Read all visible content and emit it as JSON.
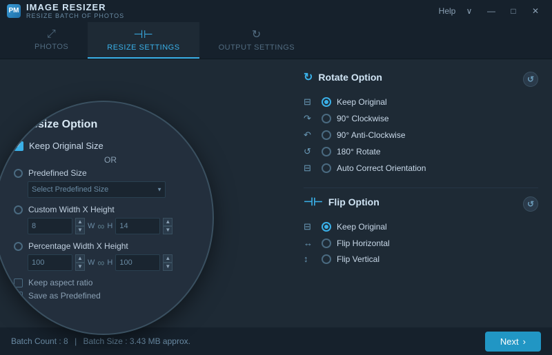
{
  "app": {
    "icon": "PM",
    "name": "IMAGE RESIZER",
    "subtitle": "RESIZE BATCH OF PHOTOS"
  },
  "titlebar": {
    "help_label": "Help",
    "minimize_label": "—",
    "maximize_label": "□",
    "close_label": "✕",
    "dropdown": "∨"
  },
  "tabs": [
    {
      "id": "photos",
      "label": "PHOTOS",
      "icon": "⤢",
      "active": false
    },
    {
      "id": "resize-settings",
      "label": "RESIZE SETTINGS",
      "icon": "⊣⊢",
      "active": true
    },
    {
      "id": "output-settings",
      "label": "OUTPUT SETTINGS",
      "icon": "↻",
      "active": false
    }
  ],
  "resize_option": {
    "title": "Resize Option",
    "keep_original": {
      "label": "Keep Original Size",
      "checked": true
    },
    "or_label": "OR",
    "predefined": {
      "label": "Predefined Size",
      "select_placeholder": "Select Predefined Size"
    },
    "custom_wh": {
      "label": "Custom Width X Height",
      "width_value": "8",
      "height_value": "14",
      "w_label": "W",
      "h_label": "H"
    },
    "percentage_wh": {
      "label": "Percentage Width X Height",
      "width_value": "100",
      "height_value": "100",
      "w_label": "W",
      "h_label": "H"
    },
    "keep_aspect_ratio": {
      "label": "Keep aspect ratio",
      "checked": false
    },
    "save_as_predefined": {
      "label": "Save as Predefined",
      "checked": false
    }
  },
  "rotate_option": {
    "title": "Rotate Option",
    "options": [
      {
        "id": "keep-original",
        "label": "Keep Original",
        "selected": true
      },
      {
        "id": "90-clockwise",
        "label": "90° Clockwise",
        "selected": false
      },
      {
        "id": "90-anticlockwise",
        "label": "90° Anti-Clockwise",
        "selected": false
      },
      {
        "id": "180-rotate",
        "label": "180° Rotate",
        "selected": false
      },
      {
        "id": "auto-correct",
        "label": "Auto Correct Orientation",
        "selected": false
      }
    ]
  },
  "flip_option": {
    "title": "Flip Option",
    "options": [
      {
        "id": "keep-original",
        "label": "Keep Original",
        "selected": true
      },
      {
        "id": "flip-horizontal",
        "label": "Flip Horizontal",
        "selected": false
      },
      {
        "id": "flip-vertical",
        "label": "Flip Vertical",
        "selected": false
      }
    ]
  },
  "statusbar": {
    "batch_count_label": "Batch Count : 8",
    "separator": "|",
    "batch_size_label": "Batch Size : 3.43 MB approx."
  },
  "next_button": {
    "label": "Next",
    "arrow": "›"
  }
}
